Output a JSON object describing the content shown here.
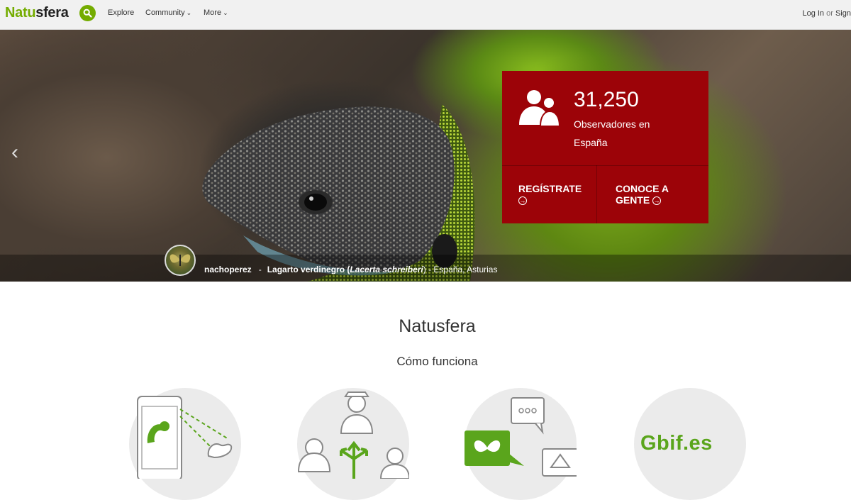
{
  "header": {
    "logo_green": "Natu",
    "logo_dark": "sfera",
    "nav": [
      {
        "label": "Explore"
      },
      {
        "label": "Community"
      },
      {
        "label": "More"
      }
    ],
    "login": "Log In",
    "or": "or",
    "signup": "Sign"
  },
  "hero": {
    "observers_count": "31,250",
    "observers_label": "Observadores en España",
    "cta_register": "REGÍSTRATE",
    "cta_meet_1": "CONOCE A",
    "cta_meet_2": "GENTE",
    "credit_user": "nachoperez",
    "credit_dash": "-",
    "credit_species": "Lagarto verdinegro (",
    "credit_latin": "Lacerta schreiberi",
    "credit_place": ") - España, Asturias"
  },
  "content": {
    "title": "Natusfera",
    "subtitle": "Cómo funciona",
    "features": [
      {
        "icon": "phone-caterpillar-icon"
      },
      {
        "icon": "people-share-icon"
      },
      {
        "icon": "chat-butterfly-icon"
      },
      {
        "icon": "gbif-logo",
        "text": "Gbif.es"
      }
    ]
  },
  "colors": {
    "brand_green": "#74ac00",
    "card_red": "#9c0308"
  }
}
